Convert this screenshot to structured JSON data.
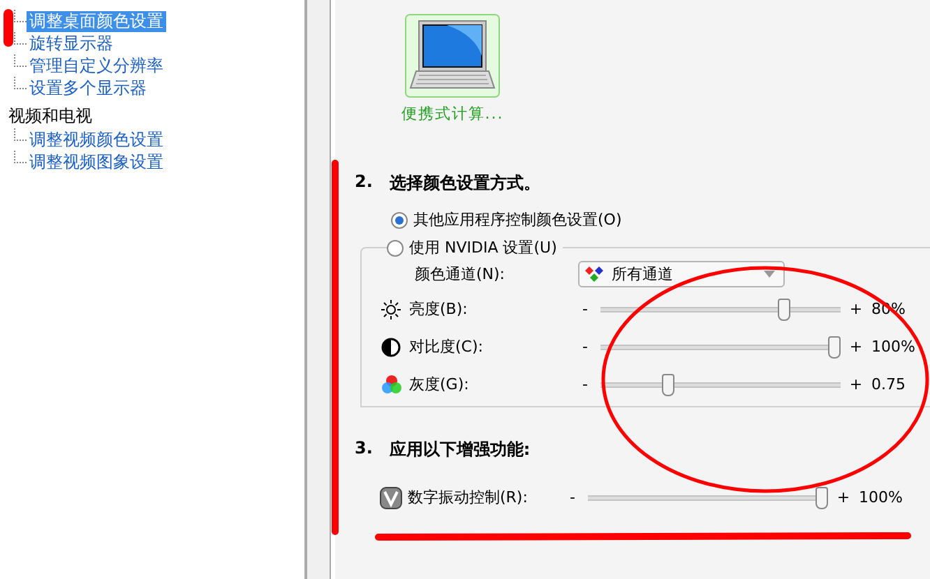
{
  "sidebar": {
    "items": [
      {
        "label": "调整桌面颜色设置",
        "selected": true
      },
      {
        "label": "旋转显示器",
        "selected": false
      },
      {
        "label": "管理自定义分辨率",
        "selected": false
      },
      {
        "label": "设置多个显示器",
        "selected": false
      }
    ],
    "groups": [
      {
        "label": "视频和电视",
        "children": [
          {
            "label": "调整视频颜色设置",
            "selected": false
          },
          {
            "label": "调整视频图象设置",
            "selected": false
          }
        ]
      }
    ]
  },
  "display": {
    "label": "便携式计算..."
  },
  "section_2": {
    "number": "2.",
    "title": "选择颜色设置方式。",
    "radios": [
      {
        "label": "其他应用程序控制颜色设置(O)",
        "selected": true
      },
      {
        "label": "使用 NVIDIA 设置(U)",
        "selected": false
      }
    ],
    "channel": {
      "label": "颜色通道(N):",
      "value": "所有通道"
    },
    "sliders": [
      {
        "kind": "brightness",
        "label": "亮度(B):",
        "minus": "-",
        "plus": "+",
        "level": 0.78,
        "reading": "80%"
      },
      {
        "kind": "contrast",
        "label": "对比度(C):",
        "minus": "-",
        "plus": "+",
        "level": 1,
        "reading": "100%"
      },
      {
        "kind": "gamma",
        "label": "灰度(G):",
        "minus": "-",
        "plus": "+",
        "level": 0.27,
        "reading": "0.75"
      }
    ]
  },
  "section_3": {
    "number": "3.",
    "title": "应用以下增强功能:",
    "sliders": [
      {
        "kind": "vibrance",
        "label": "数字振动控制(R):",
        "minus": "-",
        "plus": "+",
        "level": 1,
        "reading": "100%"
      }
    ]
  }
}
